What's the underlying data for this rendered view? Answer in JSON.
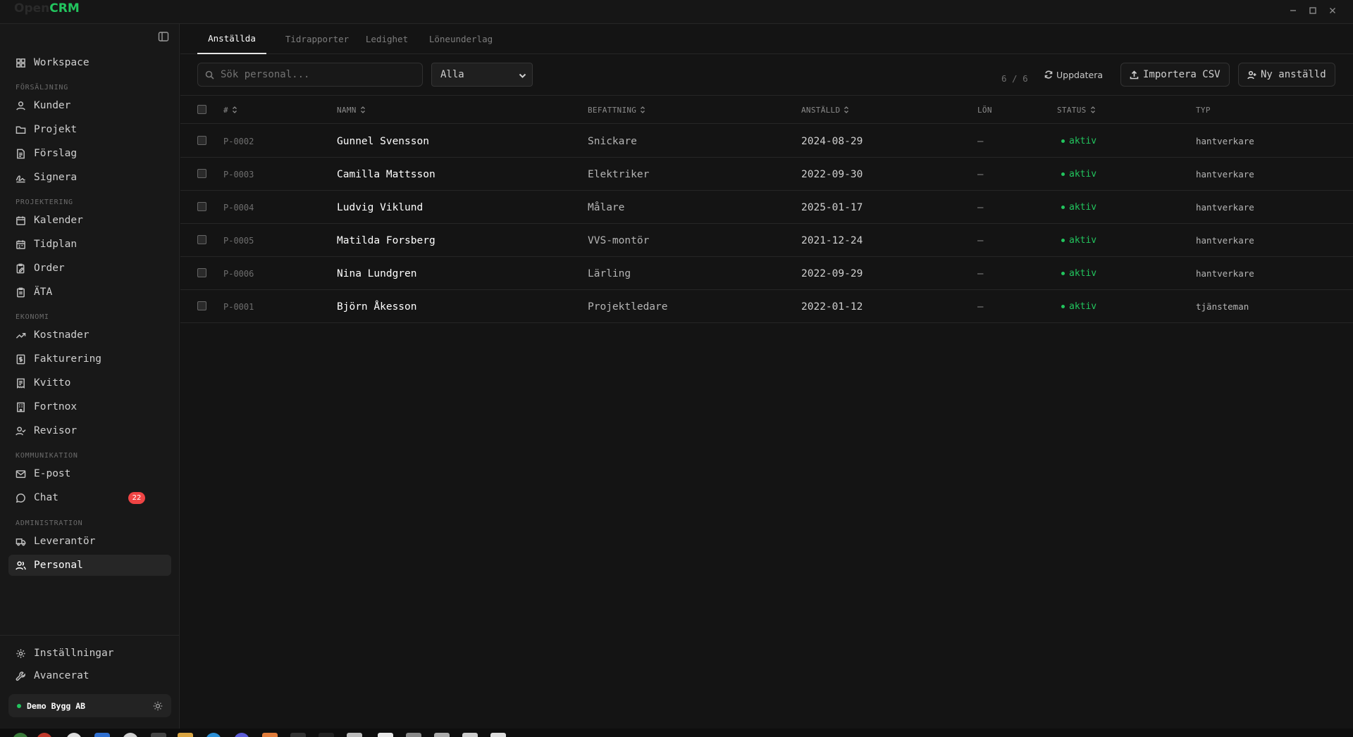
{
  "app": {
    "logo_part1": "Open",
    "logo_part2": "CRM",
    "accent_color": "#22c55e"
  },
  "window_controls": [
    "minimize-icon",
    "maximize-icon",
    "close-icon"
  ],
  "sidebar": {
    "top_item": {
      "label": "Workspace",
      "icon": "grid-icon"
    },
    "sections": [
      {
        "title": "FÖRSÄLJNING",
        "items": [
          {
            "label": "Kunder",
            "icon": "user-icon"
          },
          {
            "label": "Projekt",
            "icon": "folder-icon"
          },
          {
            "label": "Förslag",
            "icon": "document-icon"
          },
          {
            "label": "Signera",
            "icon": "signature-icon"
          }
        ]
      },
      {
        "title": "PROJEKTERING",
        "items": [
          {
            "label": "Kalender",
            "icon": "calendar-icon"
          },
          {
            "label": "Tidplan",
            "icon": "calendar-icon"
          },
          {
            "label": "Order",
            "icon": "clipboard-edit-icon"
          },
          {
            "label": "ÄTA",
            "icon": "clipboard-icon"
          }
        ]
      },
      {
        "title": "EKONOMI",
        "items": [
          {
            "label": "Kostnader",
            "icon": "trending-up-icon"
          },
          {
            "label": "Fakturering",
            "icon": "dollar-file-icon"
          },
          {
            "label": "Kvitto",
            "icon": "receipt-icon"
          },
          {
            "label": "Fortnox",
            "icon": "building-icon"
          },
          {
            "label": "Revisor",
            "icon": "user-check-icon"
          }
        ]
      },
      {
        "title": "KOMMUNIKATION",
        "items": [
          {
            "label": "E-post",
            "icon": "mail-icon"
          },
          {
            "label": "Chat",
            "icon": "chat-icon",
            "badge": "22"
          }
        ]
      },
      {
        "title": "ADMINISTRATION",
        "items": [
          {
            "label": "Leverantör",
            "icon": "truck-icon"
          },
          {
            "label": "Personal",
            "icon": "users-icon",
            "active": true
          }
        ]
      }
    ],
    "bottom_items": [
      {
        "label": "Inställningar",
        "icon": "gear-icon"
      },
      {
        "label": "Avancerat",
        "icon": "wrench-icon"
      }
    ],
    "company": "Demo Bygg AB"
  },
  "tabs": [
    {
      "label": "Anställda",
      "active": true
    },
    {
      "label": "Tidrapporter"
    },
    {
      "label": "Ledighet"
    },
    {
      "label": "Löneunderlag"
    }
  ],
  "toolbar": {
    "search_placeholder": "Sök personal...",
    "filter_value": "Alla",
    "count": "6 / 6",
    "refresh_label": "Uppdatera",
    "import_label": "Importera CSV",
    "new_label": "Ny anställd"
  },
  "table": {
    "headers": {
      "id": "#",
      "name": "NAMN",
      "position": "BEFATTNING",
      "hired": "ANSTÄLLD",
      "salary": "LÖN",
      "status": "STATUS",
      "type": "TYP"
    },
    "rows": [
      {
        "id": "P-0002",
        "name": "Gunnel Svensson",
        "position": "Snickare",
        "hired": "2024-08-29",
        "salary": "—",
        "status": "aktiv",
        "type": "hantverkare"
      },
      {
        "id": "P-0003",
        "name": "Camilla Mattsson",
        "position": "Elektriker",
        "hired": "2022-09-30",
        "salary": "—",
        "status": "aktiv",
        "type": "hantverkare"
      },
      {
        "id": "P-0004",
        "name": "Ludvig Viklund",
        "position": "Målare",
        "hired": "2025-01-17",
        "salary": "—",
        "status": "aktiv",
        "type": "hantverkare"
      },
      {
        "id": "P-0005",
        "name": "Matilda Forsberg",
        "position": "VVS-montör",
        "hired": "2021-12-24",
        "salary": "—",
        "status": "aktiv",
        "type": "hantverkare"
      },
      {
        "id": "P-0006",
        "name": "Nina Lundgren",
        "position": "Lärling",
        "hired": "2022-09-29",
        "salary": "—",
        "status": "aktiv",
        "type": "hantverkare"
      },
      {
        "id": "P-0001",
        "name": "Björn Åkesson",
        "position": "Projektledare",
        "hired": "2022-01-12",
        "salary": "—",
        "status": "aktiv",
        "type": "tjänsteman"
      }
    ]
  }
}
